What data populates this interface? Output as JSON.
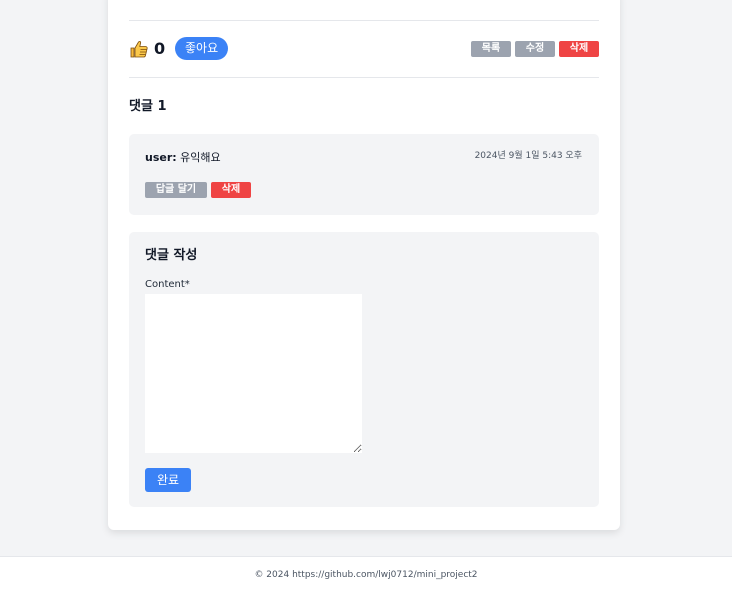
{
  "post": {
    "like_count": "0",
    "like_button_label": "좋아요",
    "list_button_label": "목록",
    "edit_button_label": "수정",
    "delete_button_label": "삭제"
  },
  "comments": {
    "title": "댓글 1",
    "items": [
      {
        "author": "user:",
        "text": "유익해요",
        "timestamp": "2024년 9월 1일 5:43 오후",
        "reply_label": "답글 달기",
        "delete_label": "삭제"
      }
    ]
  },
  "comment_form": {
    "title": "댓글 작성",
    "content_label": "Content*",
    "content_value": "",
    "submit_label": "완료"
  },
  "footer": {
    "text": "© 2024 https://github.com/lwj0712/mini_project2"
  },
  "colors": {
    "primary": "#3b82f6",
    "danger": "#ef4444",
    "muted": "#9ca3af",
    "background": "#f3f4f6"
  },
  "icons": {
    "like": "thumbs-up-icon"
  }
}
